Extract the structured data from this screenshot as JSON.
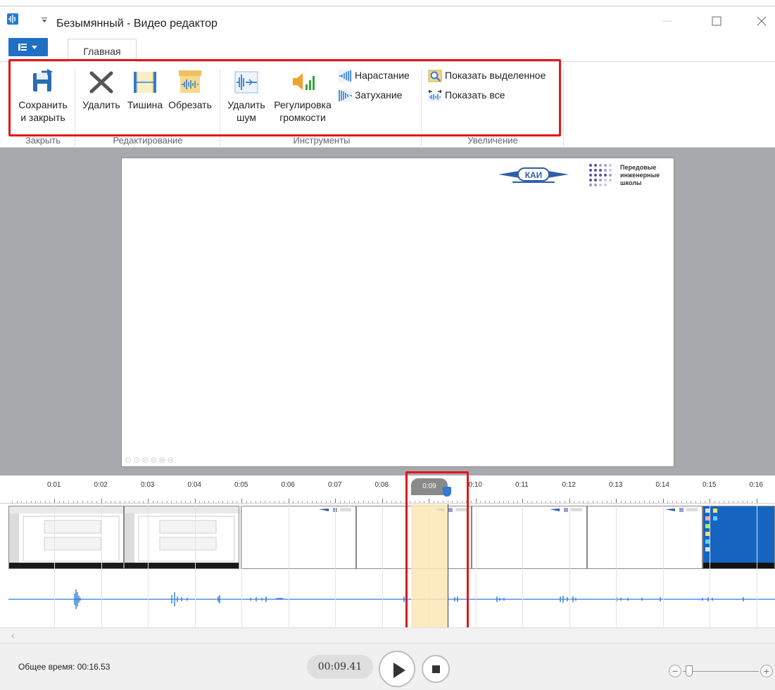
{
  "window": {
    "title": "Безымянный - Видео редактор",
    "icon": "audio-wave-icon"
  },
  "tabs": {
    "main": "Главная"
  },
  "ribbon": {
    "groups": {
      "close": "Закрыть",
      "edit": "Редактирование",
      "tools": "Инструменты",
      "zoom": "Увеличение"
    },
    "buttons": {
      "save_close_1": "Сохранить",
      "save_close_2": "и закрыть",
      "delete": "Удалить",
      "silence": "Тишина",
      "trim": "Обрезать",
      "denoise_1": "Удалить",
      "denoise_2": "шум",
      "volume_1": "Регулировка",
      "volume_2": "громкости",
      "fade_in": "Нарастание",
      "fade_out": "Затухание",
      "show_selected": "Показать выделенное",
      "show_all": "Показать все"
    }
  },
  "preview": {
    "logo_text_1": "Передовые",
    "logo_text_2": "инженерные",
    "logo_text_3": "школы",
    "kai_text": "КАИ"
  },
  "timeline": {
    "ticks": [
      "0:01",
      "0:02",
      "0:03",
      "0:04",
      "0:05",
      "0:06",
      "0:07",
      "0:08",
      "0:09",
      "0:10",
      "0:11",
      "0:12",
      "0:13",
      "0:14",
      "0:15",
      "0:16"
    ],
    "playhead_label": "0:09"
  },
  "status": {
    "total_time": "Общее время: 00:16.53",
    "current_time": "00:09.41"
  },
  "colors": {
    "accent": "#1f6fc4",
    "highlight": "#e3161b",
    "selection": "#fbe6b6",
    "wave": "#2f7bd6"
  }
}
